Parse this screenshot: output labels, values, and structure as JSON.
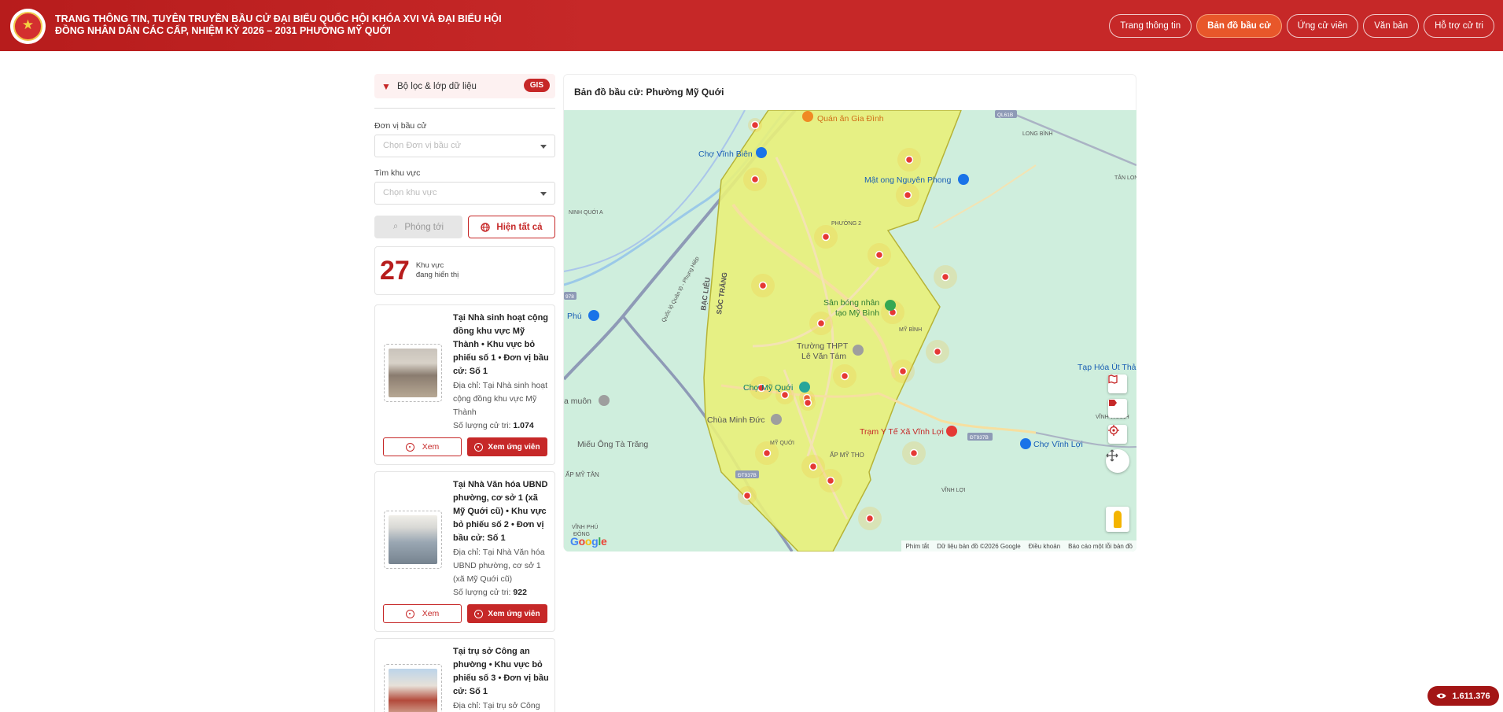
{
  "header": {
    "title": "TRANG THÔNG TIN, TUYÊN TRUYỀN BẦU CỬ ĐẠI BIỂU QUỐC HỘI KHÓA XVI VÀ ĐẠI BIỂU HỘI ĐỒNG NHÂN DÂN CÁC CẤP, NHIỆM KỲ 2026 – 2031 PHƯỜNG MỸ QUỚI",
    "nav": [
      {
        "label": "Trang thông tin",
        "active": false
      },
      {
        "label": "Bản đồ bầu cử",
        "active": true
      },
      {
        "label": "Ứng cử viên",
        "active": false
      },
      {
        "label": "Văn bản",
        "active": false
      },
      {
        "label": "Hỗ trợ cử tri",
        "active": false
      }
    ]
  },
  "sidebar": {
    "filter_label": "Bộ lọc & lớp dữ liệu",
    "gis_badge": "GIS",
    "unit_label": "Đơn vị bầu cử",
    "unit_placeholder": "Chọn Đơn vị bầu cử",
    "area_label": "Tìm khu vực",
    "area_placeholder": "Chọn khu vực",
    "zoom_button": "Phóng tới",
    "show_all_button": "Hiện tất cả",
    "count": "27",
    "count_line1": "Khu vực",
    "count_line2": "đang hiển thị",
    "cards": [
      {
        "title": "Tại Nhà sinh hoạt cộng đồng khu vực Mỹ Thành • Khu vực bỏ phiếu số 1 • Đơn vị bầu cử: Số 1",
        "address": "Địa chỉ: Tại Nhà sinh hoạt cộng đồng khu vực Mỹ Thành",
        "voters_label": "Số lượng cử tri:",
        "voters": "1.074",
        "view": "Xem",
        "candidates": "Xem ứng viên"
      },
      {
        "title": "Tại Nhà Văn hóa UBND phường, cơ sở 1 (xã Mỹ Quới cũ) • Khu vực bỏ phiếu số 2 • Đơn vị bầu cử: Số 1",
        "address": "Địa chỉ: Tại Nhà Văn hóa UBND phường, cơ sở 1 (xã Mỹ Quới cũ)",
        "voters_label": "Số lượng cử tri:",
        "voters": "922",
        "view": "Xem",
        "candidates": "Xem ứng viên"
      },
      {
        "title": "Tại trụ sở Công an phường • Khu vực bỏ phiếu số 3 • Đơn vị bầu cử: Số 1",
        "address": "Địa chỉ: Tại trụ sở Công"
      }
    ]
  },
  "map": {
    "title": "Bản đồ bầu cử: Phường Mỹ Quới",
    "labels": {
      "quan_an": "Quán ăn Gia Đình",
      "cho_vinh_bien": "Chợ Vĩnh Biên",
      "long_binh": "LONG BÌNH",
      "ql61b": "QL61B",
      "tan_long": "TÂN LONG",
      "mat_ong": "Mật ong Nguyên Phong",
      "ninh_quoi_a": "NINH QUỚI A",
      "phuong_2": "PHƯỜNG 2",
      "bac_lieu": "BẠC LIÊU",
      "soc_trang": "SÓC TRĂNG",
      "ql1_road": "Quốc lộ Quản lộ - Phụng Hiệp",
      "r978": "978",
      "phu": "Phú",
      "san_bong_1": "Sân bóng nhân",
      "san_bong_2": "tạo Mỹ Bình",
      "my_binh": "MỸ BÌNH",
      "truong_1": "Trường THPT",
      "truong_2": "Lê Văn Tám",
      "tap_hoa": "Tạp Hóa Út Thả",
      "a_muon": "a muôn",
      "cho_my_quoi": "Chợ Mỹ Quới",
      "vinh_thanh": "VĨNH THÀNH",
      "chua_minh_duc": "Chùa Minh Đức",
      "tram_y_te": "Trạm Y Tế Xã Vĩnh Lợi",
      "dt937b": "ĐT937B",
      "cho_vinh_loi": "Chợ Vĩnh Lợi",
      "mieu": "Miếu Ông Tà Trăng",
      "my_quoi": "MỸ QUỚI",
      "ap_my_tho": "ẤP MỸ THO",
      "ap_my_tan": "ẤP MỸ TÂN",
      "dt937b_2": "ĐT937B",
      "vinh_loi": "VĨNH LỢI",
      "vinh_phu_1": "VĨNH PHÚ",
      "vinh_phu_2": "ĐÔNG"
    },
    "google": "Google",
    "attribution": [
      "Phím tắt",
      "Dữ liệu bản đồ ©2026 Google",
      "Điều khoản",
      "Báo cáo một lỗi bản đồ"
    ],
    "controls": [
      "map-layers-icon",
      "label-icon",
      "locate-icon",
      "fullscreen-icon",
      "pegman-icon"
    ]
  },
  "view_counter": "1.611.376",
  "colors": {
    "brand_red": "#c62828",
    "active_nav": "#e8572a",
    "ward_fill": "#e8ef7a",
    "map_bg": "#cfeedd"
  }
}
